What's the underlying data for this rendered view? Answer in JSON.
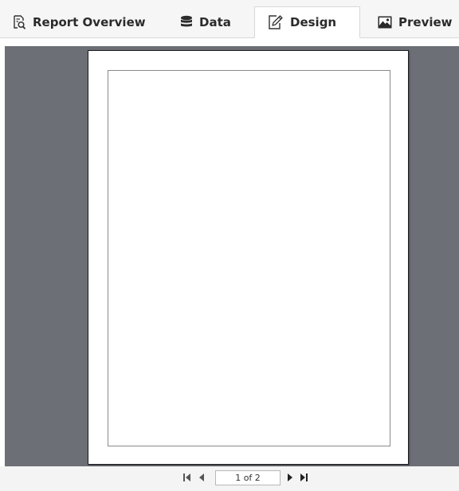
{
  "tabs": {
    "report_overview": "Report Overview",
    "data": "Data",
    "design": "Design",
    "preview": "Preview",
    "active": "design"
  },
  "pager": {
    "page_indicator": "1 of 2"
  },
  "icons": {
    "report_overview": "report-search-icon",
    "data": "database-icon",
    "design": "edit-document-icon",
    "preview": "image-icon",
    "first": "first-page-icon",
    "prev": "previous-page-icon",
    "next": "next-page-icon",
    "last": "last-page-icon"
  },
  "colors": {
    "workspace_background": "#6c7076",
    "tabbar_background": "#f6f6f6",
    "page_background": "#ffffff"
  }
}
